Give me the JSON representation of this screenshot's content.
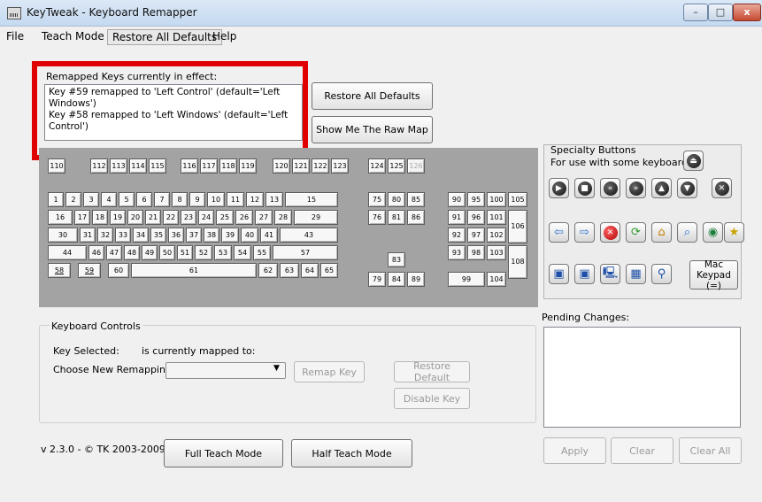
{
  "window": {
    "title": "KeyTweak -  Keyboard Remapper",
    "minimize": "–",
    "maximize": "□",
    "close": "x"
  },
  "menu": [
    "File",
    "Teach Mode",
    "Restore All Defaults",
    "Help"
  ],
  "remapped": {
    "label": "Remapped Keys currently in effect:",
    "items": [
      "Key #59 remapped to 'Left Control' (default='Left Windows')",
      "Key #58 remapped to 'Left Windows' (default='Left Control')"
    ]
  },
  "buttons": {
    "restore_all": "Restore All Defaults",
    "raw_map": "Show Me The Raw Map",
    "remap_key": "Remap Key",
    "restore_default": "Restore Default",
    "disable_key": "Disable Key",
    "full_teach": "Full Teach Mode",
    "half_teach": "Half Teach Mode",
    "apply": "Apply",
    "clear": "Clear",
    "clear_all": "Clear All"
  },
  "keyboard": {
    "function_row": [
      "110",
      "112",
      "113",
      "114",
      "115",
      "116",
      "117",
      "118",
      "119",
      "120",
      "121",
      "122",
      "123",
      "124",
      "125",
      "126"
    ],
    "row1": [
      "1",
      "2",
      "3",
      "4",
      "5",
      "6",
      "7",
      "8",
      "9",
      "10",
      "11",
      "12",
      "13",
      "15"
    ],
    "row2": [
      "16",
      "17",
      "18",
      "19",
      "20",
      "21",
      "22",
      "23",
      "24",
      "25",
      "26",
      "27",
      "28",
      "29"
    ],
    "row3": [
      "30",
      "31",
      "32",
      "33",
      "34",
      "35",
      "36",
      "37",
      "38",
      "39",
      "40",
      "41",
      "43"
    ],
    "row4": [
      "44",
      "46",
      "47",
      "48",
      "49",
      "50",
      "51",
      "52",
      "53",
      "54",
      "55",
      "57"
    ],
    "row5": [
      "58",
      "59",
      "60",
      "61",
      "62",
      "63",
      "64",
      "65"
    ],
    "nav": [
      "75",
      "80",
      "85",
      "76",
      "81",
      "86",
      "83",
      "79",
      "84",
      "89"
    ],
    "numpad": [
      "90",
      "95",
      "100",
      "105",
      "91",
      "96",
      "101",
      "106",
      "92",
      "97",
      "102",
      "93",
      "98",
      "103",
      "108",
      "99",
      "104"
    ]
  },
  "specialty": {
    "title": "Specialty Buttons",
    "subtitle": "For use with some keyboards",
    "mac_keypad_line1": "Mac",
    "mac_keypad_line2": "Keypad (=)"
  },
  "controls": {
    "title": "Keyboard Controls",
    "key_selected": "Key Selected:",
    "mapped_to": "is currently mapped to:",
    "choose": "Choose New Remapping",
    "select_arrow": "▼"
  },
  "pending": {
    "label": "Pending Changes:"
  },
  "version": "v 2.3.0 - © TK 2003-2009"
}
